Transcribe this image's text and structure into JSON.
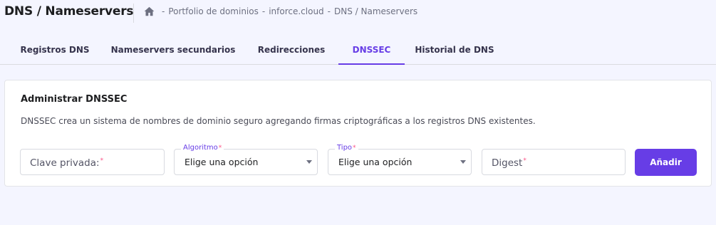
{
  "header": {
    "title": "DNS / Nameservers",
    "breadcrumb": {
      "home_icon": "home-icon",
      "separator": "-",
      "items": [
        "Portfolio de dominios",
        "inforce.cloud",
        "DNS / Nameservers"
      ]
    }
  },
  "tabs": [
    {
      "label": "Registros DNS",
      "active": false
    },
    {
      "label": "Nameservers secundarios",
      "active": false
    },
    {
      "label": "Redirecciones",
      "active": false
    },
    {
      "label": "DNSSEC",
      "active": true
    },
    {
      "label": "Historial de DNS",
      "active": false
    }
  ],
  "card": {
    "title": "Administrar DNSSEC",
    "description": "DNSSEC crea un sistema de nombres de dominio seguro agregando firmas criptográficas a los registros DNS existentes.",
    "form": {
      "private_key": {
        "placeholder": "Clave privada:",
        "required_mark": "*",
        "value": ""
      },
      "algorithm": {
        "label": "Algoritmo",
        "required_mark": "*",
        "value": "Elige una opción"
      },
      "type": {
        "label": "Tipo",
        "required_mark": "*",
        "value": "Elige una opción"
      },
      "digest": {
        "placeholder": "Digest",
        "required_mark": "*",
        "value": ""
      },
      "submit_label": "Añadir"
    }
  },
  "colors": {
    "accent": "#673de6",
    "required": "#fc5185",
    "background": "#f4f5ff"
  }
}
